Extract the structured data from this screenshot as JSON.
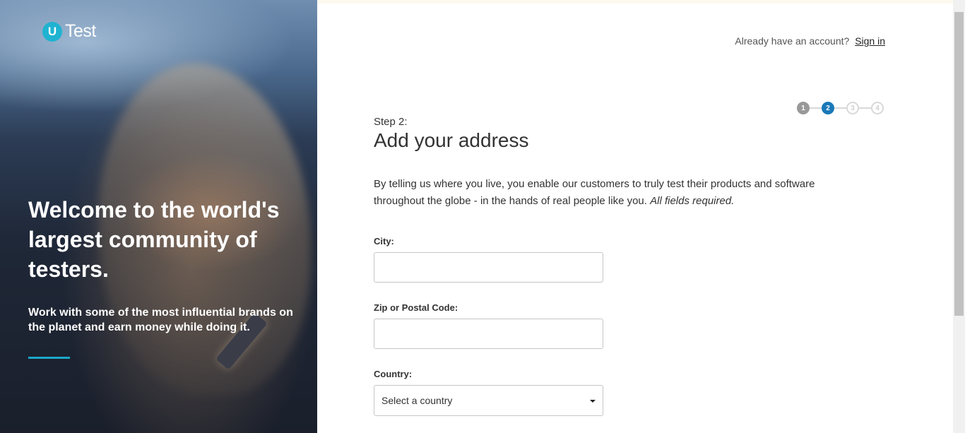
{
  "brand": {
    "badge": "U",
    "name": "Test",
    "accent_color": "#1fb3d1"
  },
  "hero": {
    "title": "Welcome to the world's largest community of testers.",
    "subtitle": "Work with some of the most influential brands on the planet and earn money while doing it."
  },
  "header": {
    "account_prompt": "Already have an account?",
    "signin_label": "Sign in"
  },
  "stepper": {
    "steps": [
      "1",
      "2",
      "3",
      "4"
    ],
    "current": 2,
    "active_color": "#1a78b8"
  },
  "form": {
    "step_label": "Step 2:",
    "title": "Add your address",
    "description": "By telling us where you live, you enable our customers to truly test their products and software throughout the globe - in the hands of real people like you.",
    "required_note": "All fields required.",
    "city": {
      "label": "City:",
      "value": ""
    },
    "zip": {
      "label": "Zip or Postal Code:",
      "value": ""
    },
    "country": {
      "label": "Country:",
      "selected": "Select a country"
    }
  }
}
